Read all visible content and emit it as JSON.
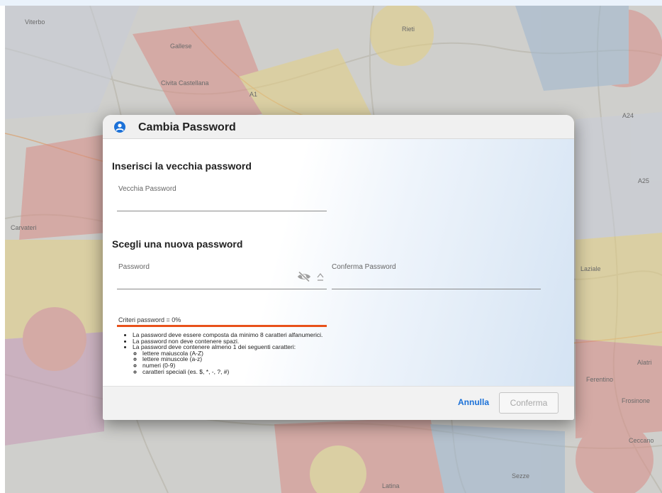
{
  "map": {
    "places": [
      "Viterbo",
      "Gallese",
      "Civita Castellana",
      "A1",
      "Rieti",
      "Carvateri",
      "Latina",
      "A24",
      "A25",
      "Sezze",
      "Ceccano",
      "Frosinone",
      "Ferentino",
      "Alatri",
      "Laziale"
    ],
    "accent_colors": [
      "#d98d86",
      "#9fb7cf",
      "#e4cf83",
      "#c79ab6"
    ]
  },
  "dialog": {
    "title": "Cambia Password",
    "header_icon": "user-circle-icon",
    "old_section_title": "Inserisci la vecchia password",
    "old_password_label": "Vecchia Password",
    "old_password_value": "",
    "new_section_title": "Scegli una nuova password",
    "password_label": "Password",
    "password_value": "",
    "confirm_label": "Conferma Password",
    "confirm_value": "",
    "strength_text": "Criteri password = 0%",
    "strength_percent": 0,
    "rules": [
      "La password deve essere composta da minimo 8 caratteri alfanumerici.",
      "La password non deve contenere spazi.",
      "La password deve contenere almeno 1 dei seguenti caratteri:"
    ],
    "subrules": [
      "lettere maiuscola (A-Z)",
      "lettere minuscole (a-z)",
      "numeri (0-9)",
      "caratteri speciali (es. $, *, -, ?, #)"
    ],
    "cancel_label": "Annulla",
    "confirm_button_label": "Conferma",
    "colors": {
      "accent": "#1b71d8",
      "strength_bar": "#e8511a"
    }
  }
}
